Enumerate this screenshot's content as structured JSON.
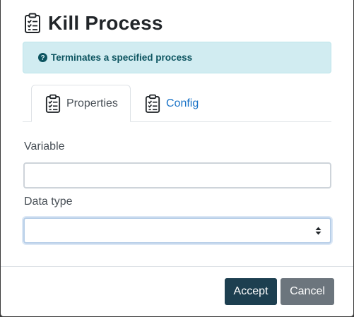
{
  "dialog": {
    "title": "Kill Process",
    "title_icon": "clipboard-checklist-icon"
  },
  "info_alert": {
    "icon": "question-circle-icon",
    "text": "Terminates a specified process"
  },
  "tabs": [
    {
      "label": "Properties",
      "icon": "clipboard-checklist-icon",
      "active": true
    },
    {
      "label": "Config",
      "icon": "clipboard-checklist-icon",
      "active": false
    }
  ],
  "form": {
    "variable": {
      "label": "Variable",
      "value": ""
    },
    "data_type": {
      "label": "Data type",
      "selected": ""
    }
  },
  "footer": {
    "accept_label": "Accept",
    "cancel_label": "Cancel"
  },
  "colors": {
    "alert_bg": "#d1ecf1",
    "alert_text": "#0c5460",
    "link_blue": "#1a73c7",
    "accept_bg": "#1d3f50",
    "cancel_bg": "#6c757d"
  }
}
